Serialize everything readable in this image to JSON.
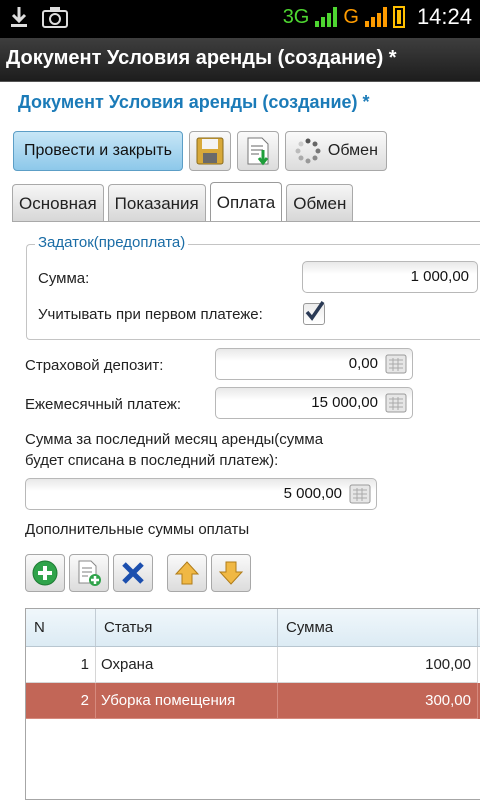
{
  "status_bar": {
    "network_1": "3G",
    "network_2": "G",
    "time": "14:24",
    "icons": [
      "download-icon",
      "camera-icon",
      "signal-icon",
      "battery-icon"
    ]
  },
  "app_bar": {
    "title": "Документ Условия аренды (создание) *"
  },
  "form": {
    "title": "Документ Условия аренды (создание) *",
    "toolbar": {
      "post_close_label": "Провести и закрыть",
      "exchange_label": "Обмен"
    },
    "tabs": [
      {
        "label": "Основная",
        "active": false
      },
      {
        "label": "Показания",
        "active": false
      },
      {
        "label": "Оплата",
        "active": true
      },
      {
        "label": "Обмен",
        "active": false
      }
    ],
    "deposit_group": {
      "legend": "Задаток(предоплата)",
      "amount_label": "Сумма:",
      "amount_value": "1 000,00",
      "first_payment_label": "Учитывать при первом платеже:",
      "first_payment_checked": true
    },
    "insurance_label": "Страховой депозит:",
    "insurance_value": "0,00",
    "monthly_label": "Ежемесячный платеж:",
    "monthly_value": "15 000,00",
    "last_month_label_line1": "Сумма за последний месяц аренды(сумма",
    "last_month_label_line2": "будет списана в последний платеж):",
    "last_month_value": "5 000,00",
    "additional_label": "Дополнительные суммы оплаты",
    "table": {
      "columns": [
        "N",
        "Статья",
        "Сумма"
      ],
      "rows": [
        {
          "n": "1",
          "item": "Охрана",
          "sum": "100,00",
          "selected": false
        },
        {
          "n": "2",
          "item": "Уборка помещения",
          "sum": "300,00",
          "selected": true
        }
      ]
    }
  },
  "colors": {
    "accent_title": "#1b7bb8",
    "selected_row": "#c26657",
    "primary_button": "#8dc8ea"
  }
}
